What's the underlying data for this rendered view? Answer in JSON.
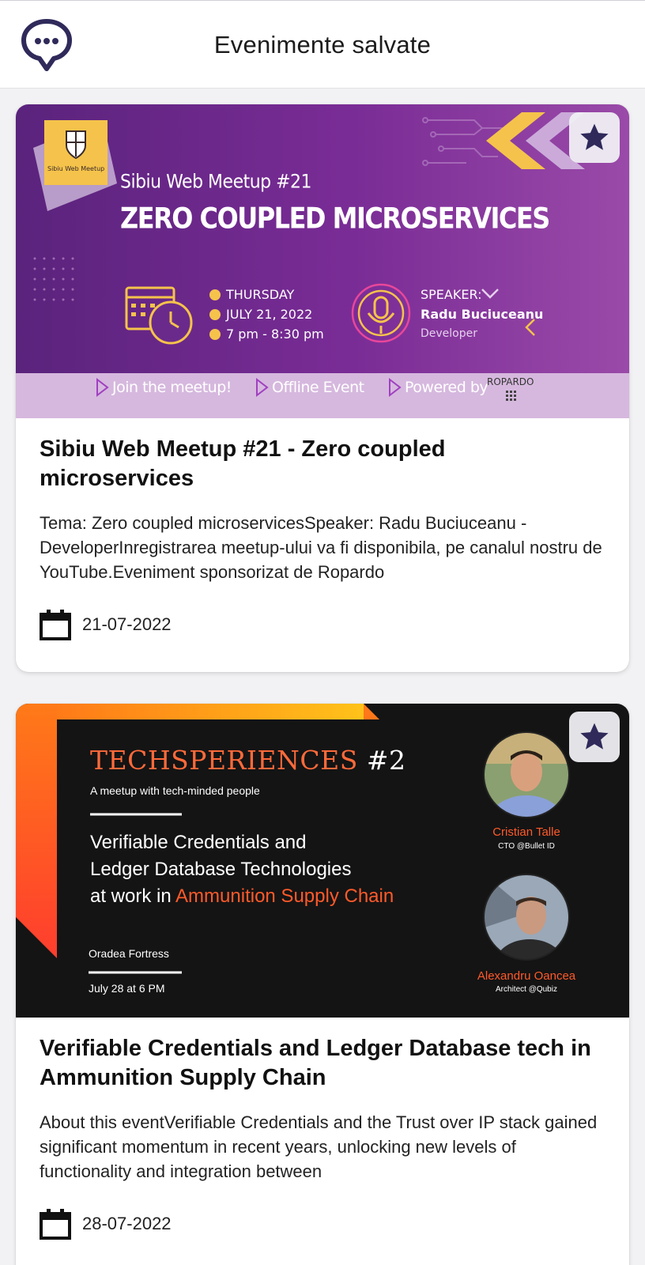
{
  "appbar": {
    "title": "Evenimente salvate",
    "logo_icon": "chat-bubble-logo-icon"
  },
  "colors": {
    "brand": "#2f2a5a",
    "purple_banner": "#6a2a8c",
    "accent_yellow": "#f5c34b",
    "techsperiences_orange": "#ff5a2a"
  },
  "events": [
    {
      "title": "Sibiu Web Meetup #21 - Zero coupled microservices",
      "description": "Tema: Zero coupled microservicesSpeaker: Radu Buciuceanu - DeveloperInregistrarea meetup-ului va fi disponibila, pe canalul nostru de YouTube.Eveniment sponsorizat de Ropardo",
      "date": "21-07-2022",
      "favorite": true,
      "banner": {
        "org_label": "Sibiu Web Meetup",
        "subtitle": "Sibiu Web Meetup #21",
        "headline": "ZERO COUPLED MICROSERVICES",
        "day": "THURSDAY",
        "day_date": "JULY 21, 2022",
        "time": "7 pm - 8:30 pm",
        "speaker_label": "SPEAKER:",
        "speaker_name": "Radu Buciuceanu",
        "speaker_role": "Developer",
        "footer_1": "Join the meetup!",
        "footer_2": "Offline Event",
        "footer_3": "Powered by",
        "sponsor_logo": "ROPARDO"
      }
    },
    {
      "title": "Verifiable Credentials and Ledger Database tech in Ammunition Supply Chain",
      "description": "About this eventVerifiable Credentials and the Trust over IP stack gained significant momentum in recent years, unlocking new levels of functionality and integration between",
      "date": "28-07-2022",
      "favorite": true,
      "banner": {
        "brand": "TECHSPERIENCES",
        "edition": "#2",
        "tagline": "A meetup with tech-minded people",
        "line1": "Verifiable Credentials and",
        "line2": "Ledger Database Technologies",
        "line3_prefix": "at work in ",
        "line3_highlight": "Ammunition Supply Chain",
        "location": "Oradea Fortress",
        "when": "July 28 at 6 PM",
        "speaker1_name": "Cristian Talle",
        "speaker1_role": "CTO @Bullet ID",
        "speaker2_name": "Alexandru Oancea",
        "speaker2_role": "Architect @Qubiz"
      }
    }
  ]
}
